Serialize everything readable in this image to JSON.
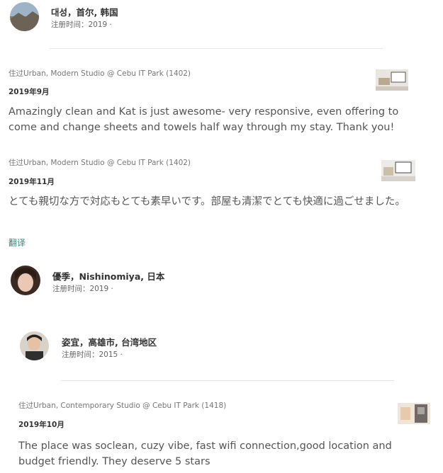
{
  "reviewers": [
    {
      "name": "대성，首尔, 韩国",
      "joined": "注册时间：2019 ·"
    },
    {
      "name": "優季，Nishinomiya, 日本",
      "joined": "注册时间：2019 ·"
    },
    {
      "name": "姿宜，高雄市, 台湾地区",
      "joined": "注册时间：2015 ·"
    }
  ],
  "reviews": [
    {
      "stayed": "住过Urban, Modern Studio @ Cebu IT Park (1402)",
      "date": "2019年9月",
      "text": "Amazingly clean and Kat is just awesome- very responsive, even offering to come and change sheets and towels half way through my stay. Thank you!"
    },
    {
      "stayed": "住过Urban, Modern Studio @ Cebu IT Park (1402)",
      "date": "2019年11月",
      "text": "とても親切な方で対応もとても素早いです。部屋も清潔でとても快適に過ごせました。",
      "translate": "翻译"
    },
    {
      "stayed": "住过Urban, Contemporary Studio @ Cebu IT Park (1418)",
      "date": "2019年10月",
      "text": "The place was soclean, cuzy vibe, fast wifi connection,good location and budget friendly. They deserve 5 stars"
    }
  ]
}
